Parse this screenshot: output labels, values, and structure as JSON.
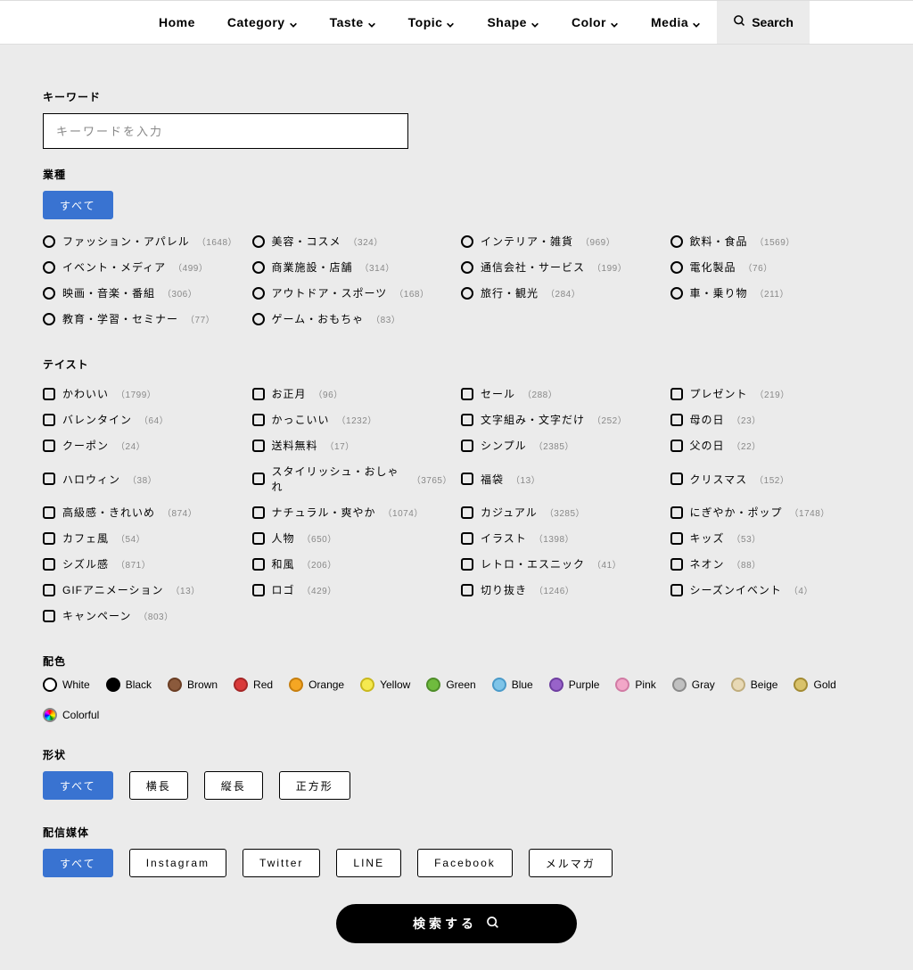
{
  "nav": {
    "items": [
      "Home",
      "Category",
      "Taste",
      "Topic",
      "Shape",
      "Color",
      "Media"
    ],
    "search": "Search"
  },
  "sections": {
    "keyword": "キーワード",
    "industry": "業種",
    "taste": "テイスト",
    "color": "配色",
    "shape": "形状",
    "media": "配信媒体"
  },
  "keyword": {
    "placeholder": "キーワードを入力"
  },
  "all": "すべて",
  "industry": [
    {
      "label": "ファッション・アパレル",
      "count": "1648"
    },
    {
      "label": "美容・コスメ",
      "count": "324"
    },
    {
      "label": "インテリア・雑貨",
      "count": "969"
    },
    {
      "label": "飲料・食品",
      "count": "1569"
    },
    {
      "label": "イベント・メディア",
      "count": "499"
    },
    {
      "label": "商業施設・店舗",
      "count": "314"
    },
    {
      "label": "通信会社・サービス",
      "count": "199"
    },
    {
      "label": "電化製品",
      "count": "76"
    },
    {
      "label": "映画・音楽・番組",
      "count": "306"
    },
    {
      "label": "アウトドア・スポーツ",
      "count": "168"
    },
    {
      "label": "旅行・観光",
      "count": "284"
    },
    {
      "label": "車・乗り物",
      "count": "211"
    },
    {
      "label": "教育・学習・セミナー",
      "count": "77"
    },
    {
      "label": "ゲーム・おもちゃ",
      "count": "83"
    }
  ],
  "taste": [
    {
      "label": "かわいい",
      "count": "1799"
    },
    {
      "label": "お正月",
      "count": "96"
    },
    {
      "label": "セール",
      "count": "288"
    },
    {
      "label": "プレゼント",
      "count": "219"
    },
    {
      "label": "バレンタイン",
      "count": "64"
    },
    {
      "label": "かっこいい",
      "count": "1232"
    },
    {
      "label": "文字組み・文字だけ",
      "count": "252"
    },
    {
      "label": "母の日",
      "count": "23"
    },
    {
      "label": "クーポン",
      "count": "24"
    },
    {
      "label": "送料無料",
      "count": "17"
    },
    {
      "label": "シンプル",
      "count": "2385"
    },
    {
      "label": "父の日",
      "count": "22"
    },
    {
      "label": "ハロウィン",
      "count": "38"
    },
    {
      "label": "スタイリッシュ・おしゃれ",
      "count": "3765"
    },
    {
      "label": "福袋",
      "count": "13"
    },
    {
      "label": "クリスマス",
      "count": "152"
    },
    {
      "label": "高級感・きれいめ",
      "count": "874"
    },
    {
      "label": "ナチュラル・爽やか",
      "count": "1074"
    },
    {
      "label": "カジュアル",
      "count": "3285"
    },
    {
      "label": "にぎやか・ポップ",
      "count": "1748"
    },
    {
      "label": "カフェ風",
      "count": "54"
    },
    {
      "label": "人物",
      "count": "650"
    },
    {
      "label": "イラスト",
      "count": "1398"
    },
    {
      "label": "キッズ",
      "count": "53"
    },
    {
      "label": "シズル感",
      "count": "871"
    },
    {
      "label": "和風",
      "count": "206"
    },
    {
      "label": "レトロ・エスニック",
      "count": "41"
    },
    {
      "label": "ネオン",
      "count": "88"
    },
    {
      "label": "GIFアニメーション",
      "count": "13"
    },
    {
      "label": "ロゴ",
      "count": "429"
    },
    {
      "label": "切り抜き",
      "count": "1246"
    },
    {
      "label": "シーズンイベント",
      "count": "4"
    },
    {
      "label": "キャンペーン",
      "count": "803"
    }
  ],
  "colors": [
    {
      "label": "White",
      "hex": "#ffffff",
      "border": "#000"
    },
    {
      "label": "Black",
      "hex": "#000000",
      "border": "#000"
    },
    {
      "label": "Brown",
      "hex": "#8b5a3c",
      "border": "#6b3e24"
    },
    {
      "label": "Red",
      "hex": "#d93a3a",
      "border": "#a52727"
    },
    {
      "label": "Orange",
      "hex": "#f5a623",
      "border": "#c77f0f"
    },
    {
      "label": "Yellow",
      "hex": "#f5e950",
      "border": "#c9b81e"
    },
    {
      "label": "Green",
      "hex": "#6fbb3e",
      "border": "#4e8d29"
    },
    {
      "label": "Blue",
      "hex": "#7ec4e8",
      "border": "#4a9ac9"
    },
    {
      "label": "Purple",
      "hex": "#9863c9",
      "border": "#6f3fa1"
    },
    {
      "label": "Pink",
      "hex": "#f2a7c8",
      "border": "#d17ba4"
    },
    {
      "label": "Gray",
      "hex": "#c0c0c0",
      "border": "#8a8a8a"
    },
    {
      "label": "Beige",
      "hex": "#e8d9b5",
      "border": "#c0ad7d"
    },
    {
      "label": "Gold",
      "hex": "#d9c26a",
      "border": "#a38b33"
    },
    {
      "label": "Colorful",
      "hex": "conic-gradient(red,orange,yellow,green,cyan,blue,magenta,red)",
      "border": "#888"
    }
  ],
  "shapes": [
    "すべて",
    "横長",
    "縦長",
    "正方形"
  ],
  "media": [
    "すべて",
    "Instagram",
    "Twitter",
    "LINE",
    "Facebook",
    "メルマガ"
  ],
  "search_button": "検索する"
}
